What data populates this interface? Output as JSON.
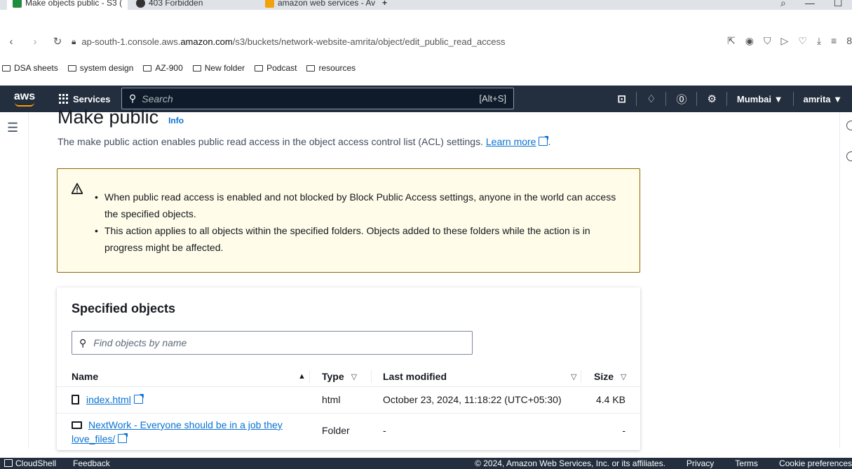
{
  "browser": {
    "tabs": [
      {
        "label": "Make objects public - S3 (",
        "favicon_color": "#1e8e3e"
      },
      {
        "label": "403 Forbidden",
        "favicon_color": "#333333"
      },
      {
        "label": "amazon web services - Av",
        "favicon_color": "#f0a30a"
      }
    ],
    "new_tab": "+",
    "url_prefix": "ap-south-1.console.aws.",
    "url_domain": "amazon.com",
    "url_path": "/s3/buckets/network-website-amrita/object/edit_public_read_access",
    "bookmarks": [
      "DSA sheets",
      "system design",
      "AZ-900",
      "New folder",
      "Podcast",
      "resources"
    ]
  },
  "aws_nav": {
    "logo": "aws",
    "services_label": "Services",
    "search_placeholder": "Search",
    "search_shortcut": "[Alt+S]",
    "region": "Mumbai ▼",
    "user": "amrita ▼"
  },
  "page": {
    "title": "Make public",
    "info": "Info",
    "description": "The make public action enables public read access in the object access control list (ACL) settings.",
    "learn_more": "Learn more"
  },
  "warning": {
    "items": [
      "When public read access is enabled and not blocked by Block Public Access settings, anyone in the world can access the specified objects.",
      "This action applies to all objects within the specified folders. Objects added to these folders while the action is in progress might be affected."
    ]
  },
  "objects_panel": {
    "title": "Specified objects",
    "search_placeholder": "Find objects by name",
    "columns": {
      "name": "Name",
      "type": "Type",
      "last_modified": "Last modified",
      "size": "Size"
    },
    "rows": [
      {
        "name": "index.html",
        "type": "html",
        "last_modified": "October 23, 2024, 11:18:22 (UTC+05:30)",
        "size": "4.4 KB"
      },
      {
        "name": "NextWork - Everyone should be in a job they love_files/",
        "type": "Folder",
        "last_modified": "-",
        "size": "-"
      }
    ]
  },
  "footer": {
    "cloudshell": "CloudShell",
    "feedback": "Feedback",
    "copyright": "© 2024, Amazon Web Services, Inc. or its affiliates.",
    "privacy": "Privacy",
    "terms": "Terms",
    "cookies": "Cookie preferences"
  }
}
